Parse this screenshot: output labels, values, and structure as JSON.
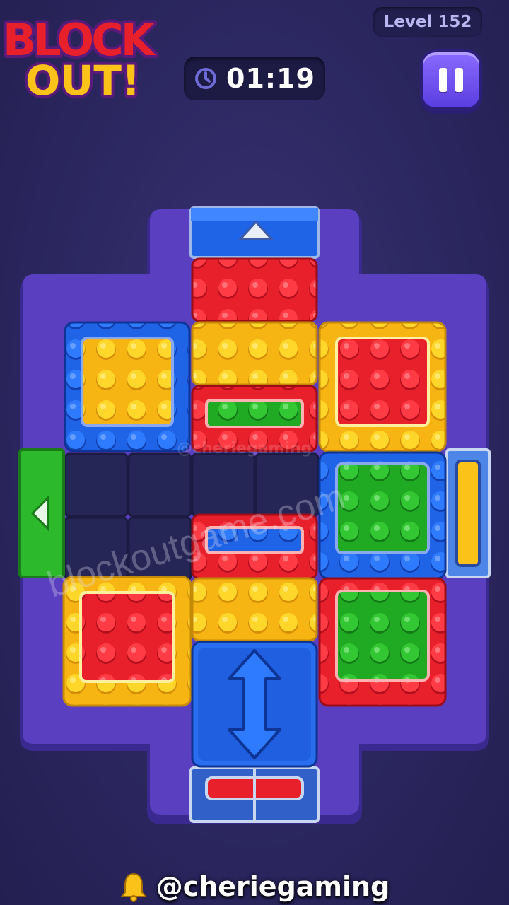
{
  "logo": {
    "line1": "BLOCK",
    "line2": "OUT!"
  },
  "header": {
    "level_label": "Level 152",
    "timer": "01:19",
    "clock_icon": "clock-icon",
    "pause_icon": "pause-icon"
  },
  "board": {
    "colors": {
      "red": "#e8202c",
      "yellow": "#fbc21a",
      "blue": "#1f63e6",
      "green": "#2cb92c",
      "frame": "#5a3fc0",
      "frame_dark": "#3a2a8f",
      "empty": "#272757"
    },
    "exits": [
      {
        "color": "blue",
        "side": "top",
        "icon": "arrow-up-icon"
      },
      {
        "color": "green",
        "side": "left",
        "icon": "arrow-left-icon"
      },
      {
        "color": "yellow",
        "side": "right",
        "icon": "gate-bar-icon"
      },
      {
        "color": "red",
        "side": "bottom",
        "icon": "gate-bar-icon"
      }
    ],
    "blocks": [
      {
        "name": "top-red-block",
        "outer": "red",
        "inner": null
      },
      {
        "name": "left-blue-yellow-block",
        "outer": "blue",
        "inner": "yellow"
      },
      {
        "name": "center-yellow-block",
        "outer": "yellow",
        "inner": null
      },
      {
        "name": "right-yellow-red-block",
        "outer": "yellow",
        "inner": "red"
      },
      {
        "name": "center-red-green-bar-block",
        "outer": "red",
        "inner": "green"
      },
      {
        "name": "right-blue-green-block",
        "outer": "blue",
        "inner": "green"
      },
      {
        "name": "center-red-blue-bar-block",
        "outer": "red",
        "inner": "blue"
      },
      {
        "name": "left-yellow-red-block",
        "outer": "yellow",
        "inner": "red"
      },
      {
        "name": "center-yellow-lower-block",
        "outer": "yellow",
        "inner": null
      },
      {
        "name": "right-red-green-block",
        "outer": "red",
        "inner": "green"
      },
      {
        "name": "blue-vertical-arrow-block",
        "outer": "blue",
        "inner": null,
        "icon": "double-arrow-vertical-icon"
      }
    ]
  },
  "watermarks": {
    "small": "@cheriegaming",
    "large": "blockoutgame.com"
  },
  "footer": {
    "bell_icon": "bell-icon",
    "handle": "@cheriegaming"
  }
}
